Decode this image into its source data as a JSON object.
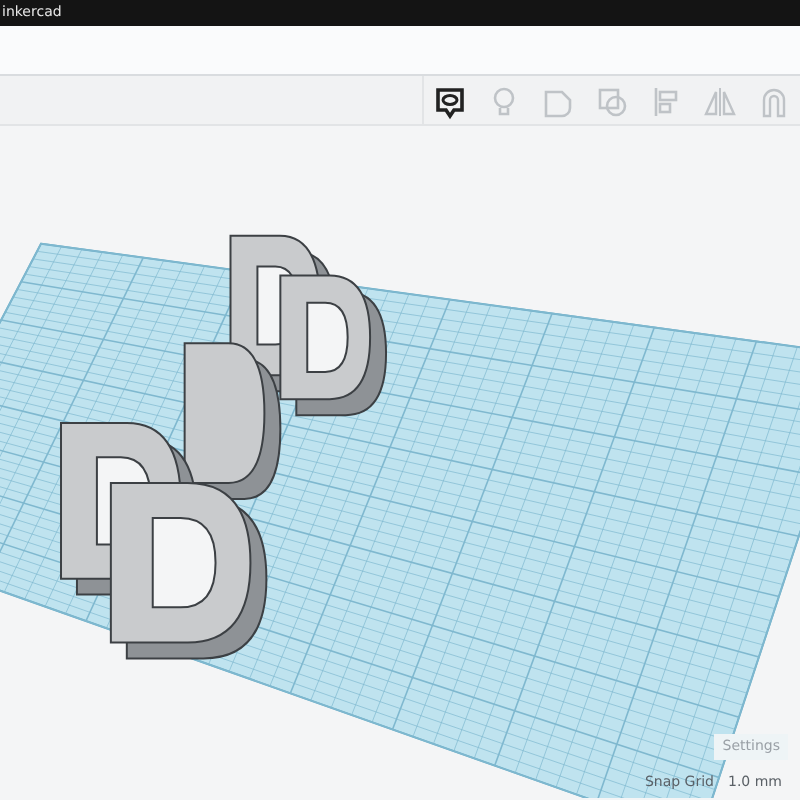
{
  "window": {
    "title": "inkercad"
  },
  "workplane": {
    "settings": "Settings",
    "snap_label": "Snap Grid",
    "snap_value": "1.0 mm"
  }
}
